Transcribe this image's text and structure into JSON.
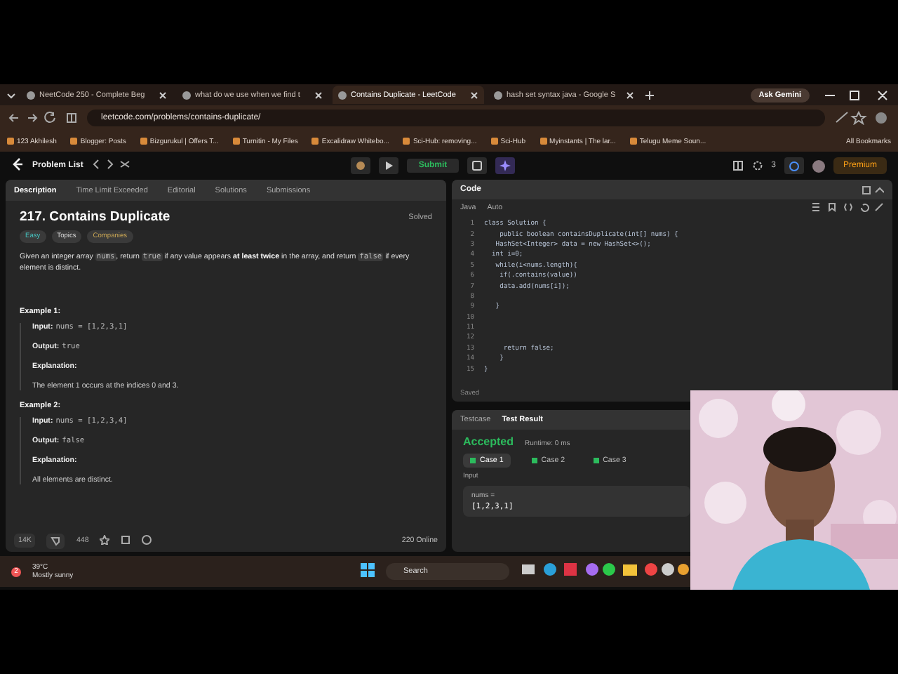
{
  "browser": {
    "tabs": [
      {
        "title": "NeetCode 250 - Complete Beg",
        "selected": false
      },
      {
        "title": "what do we use when we find t",
        "selected": false
      },
      {
        "title": "Contains Duplicate - LeetCode",
        "selected": true
      },
      {
        "title": "hash set syntax java - Google S",
        "selected": false
      }
    ],
    "ask_gemini": "Ask Gemini",
    "address": "leetcode.com/problems/contains-duplicate/",
    "bookmarks": [
      "123 Akhilesh",
      "Blogger: Posts",
      "Bizgurukul | Offers T...",
      "Turnitin - My Files",
      "Excalidraw Whitebo...",
      "Sci-Hub: removing...",
      "Sci-Hub",
      "Myinstants | The lar...",
      "Telugu Meme Soun..."
    ],
    "all_bookmarks": "All Bookmarks"
  },
  "header": {
    "problem_list": "Problem List",
    "submit": "Submit",
    "streak": "3",
    "premium": "Premium"
  },
  "description": {
    "tabs": [
      {
        "label": "Description",
        "selected": true
      },
      {
        "label": "Time Limit Exceeded",
        "selected": false
      },
      {
        "label": "Editorial",
        "selected": false
      },
      {
        "label": "Solutions",
        "selected": false
      },
      {
        "label": "Submissions",
        "selected": false
      }
    ],
    "title": "217. Contains Duplicate",
    "solved": "Solved",
    "tags": [
      {
        "label": "Easy",
        "kind": "difficulty"
      },
      {
        "label": "Topics",
        "kind": "topics"
      },
      {
        "label": "Companies",
        "kind": "companies"
      }
    ],
    "statement": [
      {
        "text": "Given an integer array ",
        "kind": "text"
      },
      {
        "text": "nums",
        "kind": "code"
      },
      {
        "text": ", return ",
        "kind": "text"
      },
      {
        "text": "true",
        "kind": "code"
      },
      {
        "text": " if any value appears ",
        "kind": "text"
      },
      {
        "text": "at least twice",
        "kind": "bold"
      },
      {
        "text": " in the array, and return ",
        "kind": "text"
      },
      {
        "text": "false",
        "kind": "code"
      },
      {
        "text": " if every element is distinct.",
        "kind": "text"
      }
    ],
    "examples": [
      {
        "title": "Example 1:",
        "input_label": "Input:",
        "input": "nums = [1,2,3,1]",
        "output_label": "Output:",
        "output": "true",
        "explanation_label": "Explanation:",
        "explanation": "The element 1 occurs at the indices 0 and 3."
      },
      {
        "title": "Example 2:",
        "input_label": "Input:",
        "input": "nums = [1,2,3,4]",
        "output_label": "Output:",
        "output": "false",
        "explanation_label": "Explanation:",
        "explanation": "All elements are distinct."
      }
    ],
    "likes": "14K",
    "comments": "448",
    "online": "220 Online"
  },
  "code": {
    "title": "Code",
    "language": "Java",
    "mode": "Auto",
    "status": "Saved",
    "lines": [
      {
        "n": "1",
        "text": "class Solution {"
      },
      {
        "n": "2",
        "text": "    public boolean containsDuplicate(int[] nums) {"
      },
      {
        "n": "3",
        "text": "   HashSet<Integer> data = new HashSet<>();"
      },
      {
        "n": "4",
        "text": "  int i=0;"
      },
      {
        "n": "5",
        "text": "   while(i<nums.length){"
      },
      {
        "n": "6",
        "text": "    if(.contains(value))"
      },
      {
        "n": "7",
        "text": "    data.add(nums[i]);"
      },
      {
        "n": "8"
      },
      {
        "n": "9",
        "text": "   }"
      },
      {
        "n": "10"
      },
      {
        "n": "11"
      },
      {
        "n": "12"
      },
      {
        "n": "13",
        "text": "     return false;"
      },
      {
        "n": "14",
        "text": "    }"
      },
      {
        "n": "15",
        "text": "}"
      }
    ]
  },
  "test": {
    "tabs": [
      {
        "label": "Testcase",
        "selected": false
      },
      {
        "label": "Test Result",
        "selected": true
      }
    ],
    "verdict": "Accepted",
    "runtime": "Runtime: 0 ms",
    "cases": [
      {
        "label": "Case 1",
        "selected": true
      },
      {
        "label": "Case 2",
        "selected": false
      },
      {
        "label": "Case 3",
        "selected": false
      }
    ],
    "input_label": "Input",
    "variable": "nums =",
    "value": "[1,2,3,1]"
  },
  "taskbar": {
    "temperature": "39°C",
    "weather": "Mostly sunny",
    "search": "Search",
    "notification": "2"
  }
}
